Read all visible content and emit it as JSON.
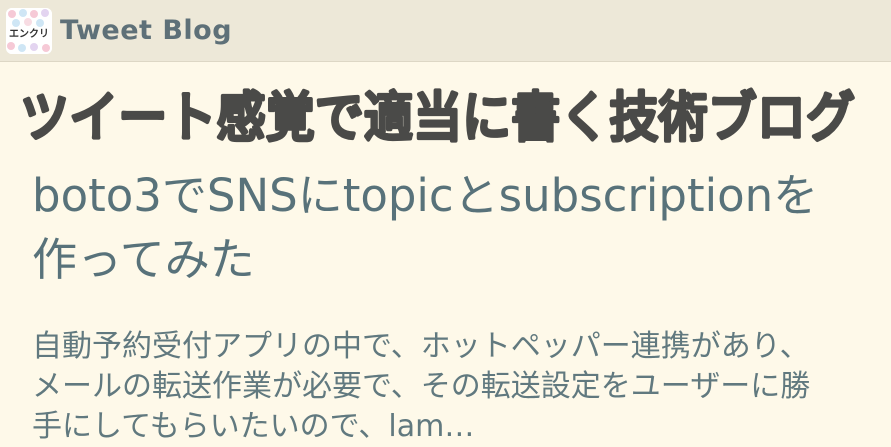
{
  "header": {
    "logo_text": "エンクリ",
    "site_title": "Tweet Blog"
  },
  "banner": {
    "tagline": "ツイート感覚で適当に書く技術ブログ"
  },
  "post": {
    "title": "boto3でSNSにtopicとsubscriptionを作ってみた",
    "excerpt": "自動予約受付アプリの中で、ホットペッパー連携があり、メールの転送作業が必要で、その転送設定をユーザーに勝手にしてもらいたいので、lam…"
  },
  "colors": {
    "header_bg": "#ede8d8",
    "page_bg": "#fef9e9",
    "title_text": "#58727a",
    "banner_text": "#4a4a48"
  }
}
